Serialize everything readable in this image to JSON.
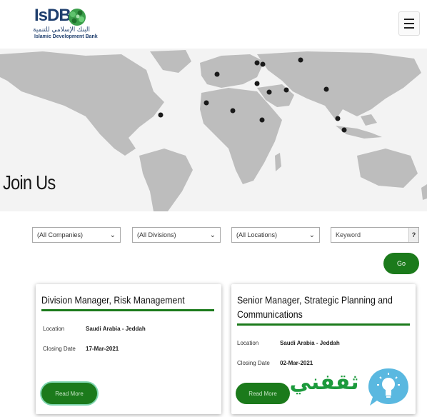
{
  "header": {
    "logo_text": "IsDB",
    "logo_arabic": "البنك الإسلامي للتنمية",
    "logo_english": "Islamic Development Bank",
    "menu_icon": "hamburger-menu-icon"
  },
  "hero": {
    "title": "Join Us",
    "map": "world-map",
    "marker_color": "#1a1a1a"
  },
  "filters": {
    "companies": "(All Companies)",
    "divisions": "(All Divisions)",
    "locations": "(All Locations)",
    "keyword_placeholder": "Keyword",
    "keyword_help": "?",
    "go_label": "Go"
  },
  "jobs": [
    {
      "title": "Division Manager, Risk Management",
      "location_label": "Location",
      "location": "Saudi Arabia - Jeddah",
      "closing_label": "Closing Date",
      "closing_date": "17-Mar-2021",
      "read_more": "Read More"
    },
    {
      "title": "Senior Manager, Strategic Planning and Communications",
      "location_label": "Location",
      "location": "Saudi Arabia - Jeddah",
      "closing_label": "Closing Date",
      "closing_date": "02-Mar-2021",
      "read_more": "Read More"
    }
  ],
  "watermark": {
    "text": "ثقفني",
    "icon": "lightbulb-icon"
  },
  "colors": {
    "brand_green": "#1b7a1b",
    "brand_blue": "#1f3f6e",
    "map_land": "#bdbdbd"
  }
}
